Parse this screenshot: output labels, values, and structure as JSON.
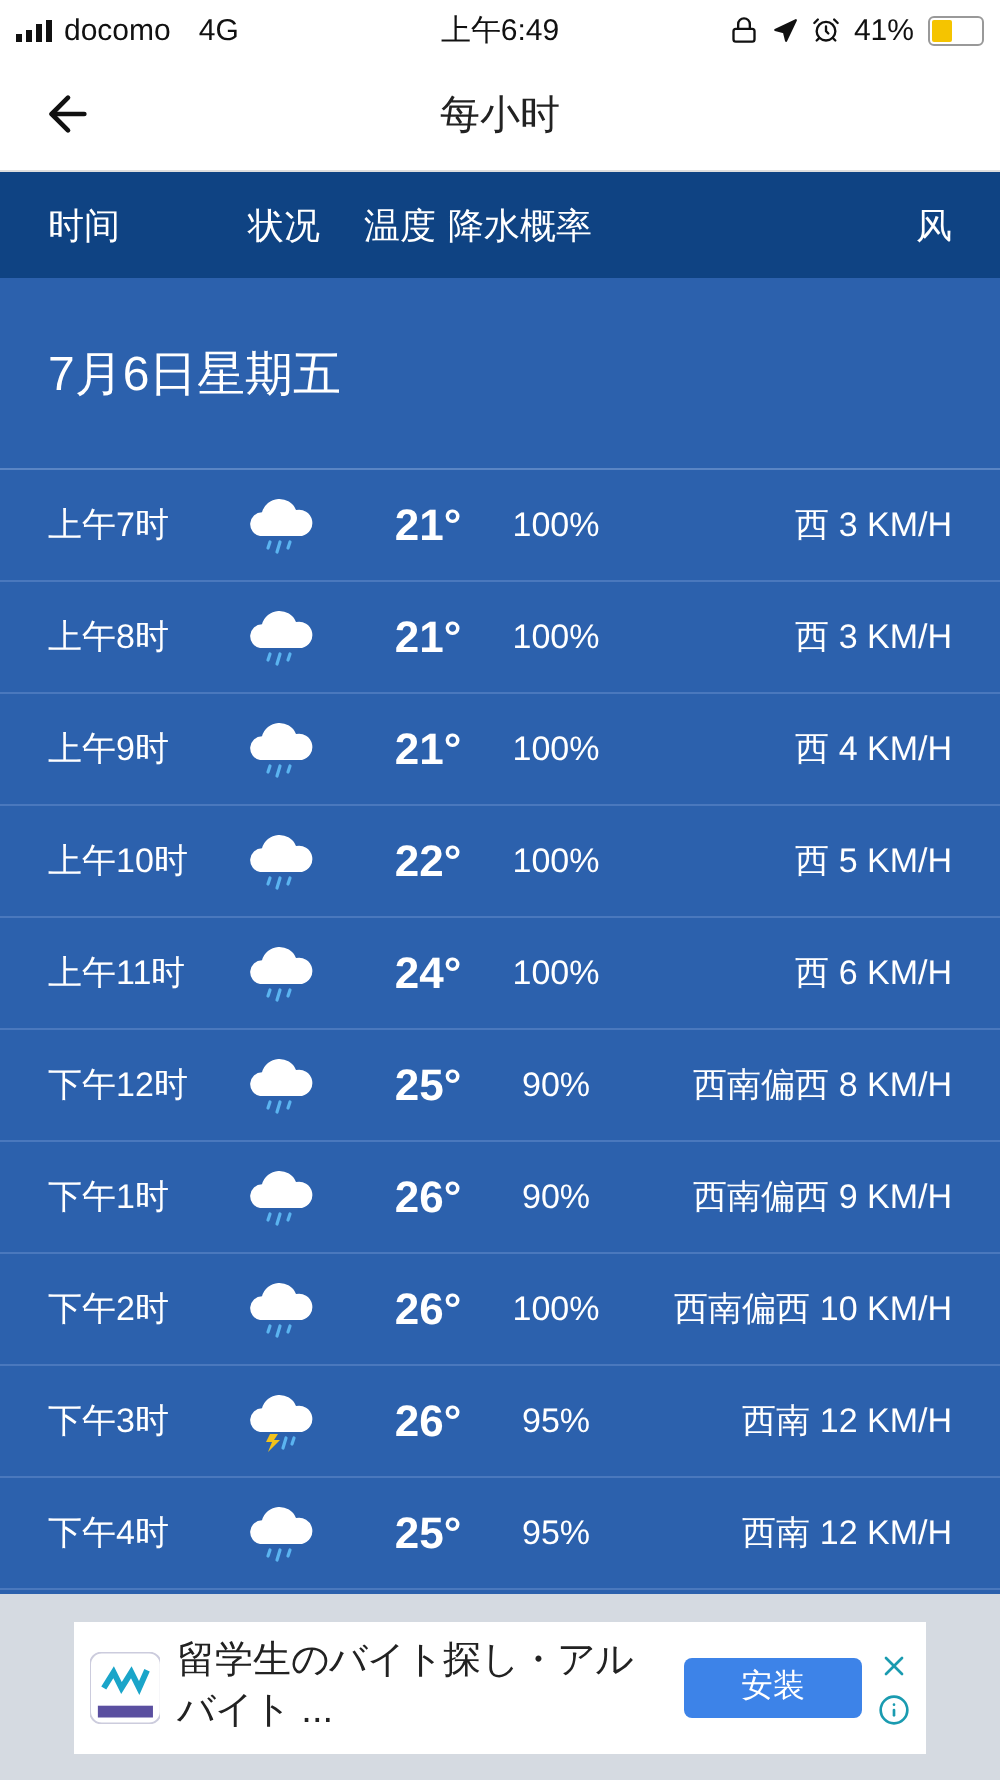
{
  "status_bar": {
    "carrier": "docomo",
    "network": "4G",
    "time": "上午6:49",
    "battery": "41%"
  },
  "nav": {
    "title": "每小时"
  },
  "columns": [
    "时间",
    "状况",
    "温度",
    "降水概率",
    "风"
  ],
  "date": "7月6日星期五",
  "rows": [
    {
      "time": "上午7时",
      "kind": "rain",
      "temp": "21°",
      "precip": "100%",
      "wind": "西 3 KM/H"
    },
    {
      "time": "上午8时",
      "kind": "rain",
      "temp": "21°",
      "precip": "100%",
      "wind": "西 3 KM/H"
    },
    {
      "time": "上午9时",
      "kind": "rain",
      "temp": "21°",
      "precip": "100%",
      "wind": "西 4 KM/H"
    },
    {
      "time": "上午10时",
      "kind": "rain",
      "temp": "22°",
      "precip": "100%",
      "wind": "西 5 KM/H"
    },
    {
      "time": "上午11时",
      "kind": "rain",
      "temp": "24°",
      "precip": "100%",
      "wind": "西 6 KM/H"
    },
    {
      "time": "下午12时",
      "kind": "rain",
      "temp": "25°",
      "precip": "90%",
      "wind": "西南偏西 8 KM/H"
    },
    {
      "time": "下午1时",
      "kind": "rain",
      "temp": "26°",
      "precip": "90%",
      "wind": "西南偏西 9 KM/H"
    },
    {
      "time": "下午2时",
      "kind": "rain",
      "temp": "26°",
      "precip": "100%",
      "wind": "西南偏西 10 KM/H"
    },
    {
      "time": "下午3时",
      "kind": "thunder",
      "temp": "26°",
      "precip": "95%",
      "wind": "西南 12 KM/H"
    },
    {
      "time": "下午4时",
      "kind": "rain",
      "temp": "25°",
      "precip": "95%",
      "wind": "西南 12 KM/H"
    }
  ],
  "ad": {
    "text": "留学生のバイト探し・アルバイト ...",
    "button": "安装"
  }
}
